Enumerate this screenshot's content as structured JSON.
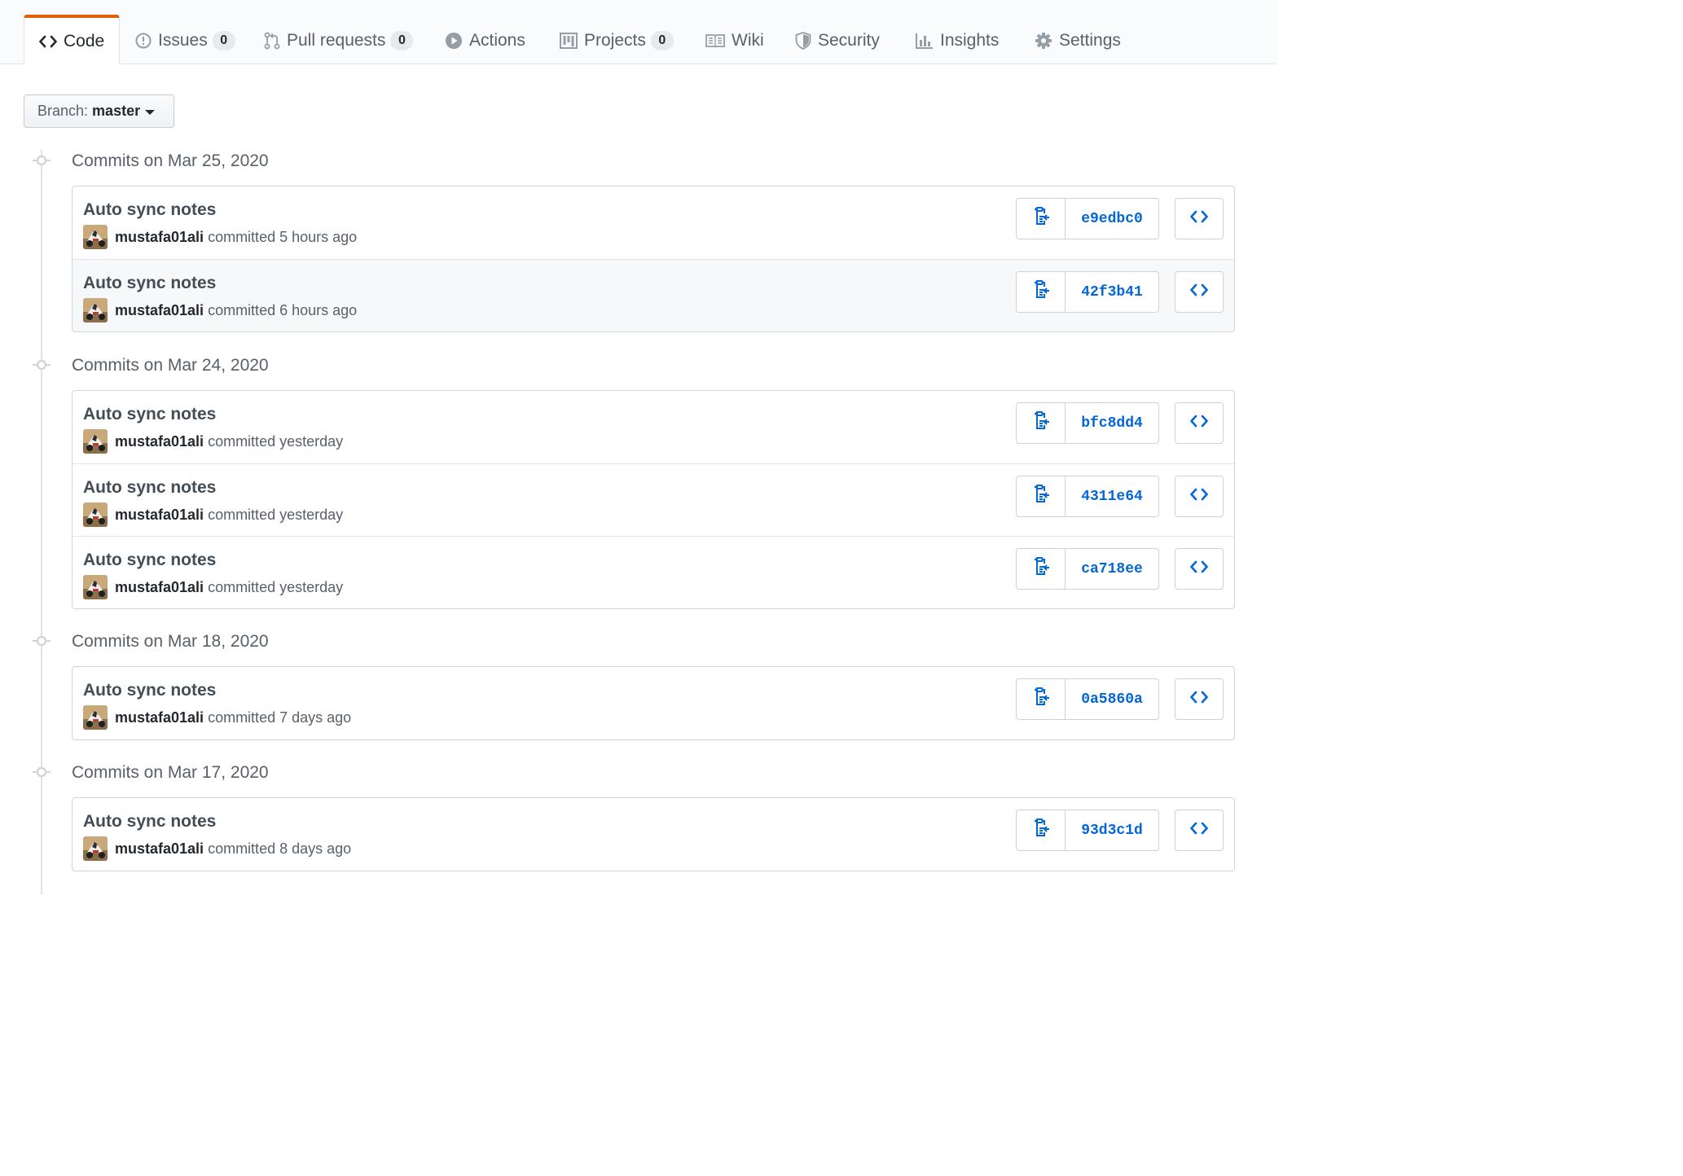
{
  "nav": {
    "tabs": [
      {
        "label": "Code",
        "icon": "code-icon",
        "selected": true
      },
      {
        "label": "Issues",
        "icon": "issue-opened-icon",
        "count": "0"
      },
      {
        "label": "Pull requests",
        "icon": "git-pull-request-icon",
        "count": "0"
      },
      {
        "label": "Actions",
        "icon": "play-icon"
      },
      {
        "label": "Projects",
        "icon": "project-icon",
        "count": "0"
      },
      {
        "label": "Wiki",
        "icon": "book-icon"
      },
      {
        "label": "Security",
        "icon": "shield-icon"
      },
      {
        "label": "Insights",
        "icon": "graph-icon"
      },
      {
        "label": "Settings",
        "icon": "gear-icon"
      }
    ]
  },
  "branch": {
    "prefix": "Branch:",
    "name": "master"
  },
  "groups": [
    {
      "date": "Commits on Mar 25, 2020",
      "commits": [
        {
          "title": "Auto sync notes",
          "author": "mustafa01ali",
          "verb": "committed",
          "time": "5 hours ago",
          "sha": "e9edbc0"
        },
        {
          "title": "Auto sync notes",
          "author": "mustafa01ali",
          "verb": "committed",
          "time": "6 hours ago",
          "sha": "42f3b41"
        }
      ]
    },
    {
      "date": "Commits on Mar 24, 2020",
      "commits": [
        {
          "title": "Auto sync notes",
          "author": "mustafa01ali",
          "verb": "committed",
          "time": "yesterday",
          "sha": "bfc8dd4"
        },
        {
          "title": "Auto sync notes",
          "author": "mustafa01ali",
          "verb": "committed",
          "time": "yesterday",
          "sha": "4311e64"
        },
        {
          "title": "Auto sync notes",
          "author": "mustafa01ali",
          "verb": "committed",
          "time": "yesterday",
          "sha": "ca718ee"
        }
      ]
    },
    {
      "date": "Commits on Mar 18, 2020",
      "commits": [
        {
          "title": "Auto sync notes",
          "author": "mustafa01ali",
          "verb": "committed",
          "time": "7 days ago",
          "sha": "0a5860a"
        }
      ]
    },
    {
      "date": "Commits on Mar 17, 2020",
      "commits": [
        {
          "title": "Auto sync notes",
          "author": "mustafa01ali",
          "verb": "committed",
          "time": "8 days ago",
          "sha": "93d3c1d"
        }
      ]
    }
  ],
  "colors": {
    "accent_orange": "#e36209",
    "link_blue": "#0366d6",
    "muted_text": "#586069",
    "border": "#e1e4e8"
  }
}
